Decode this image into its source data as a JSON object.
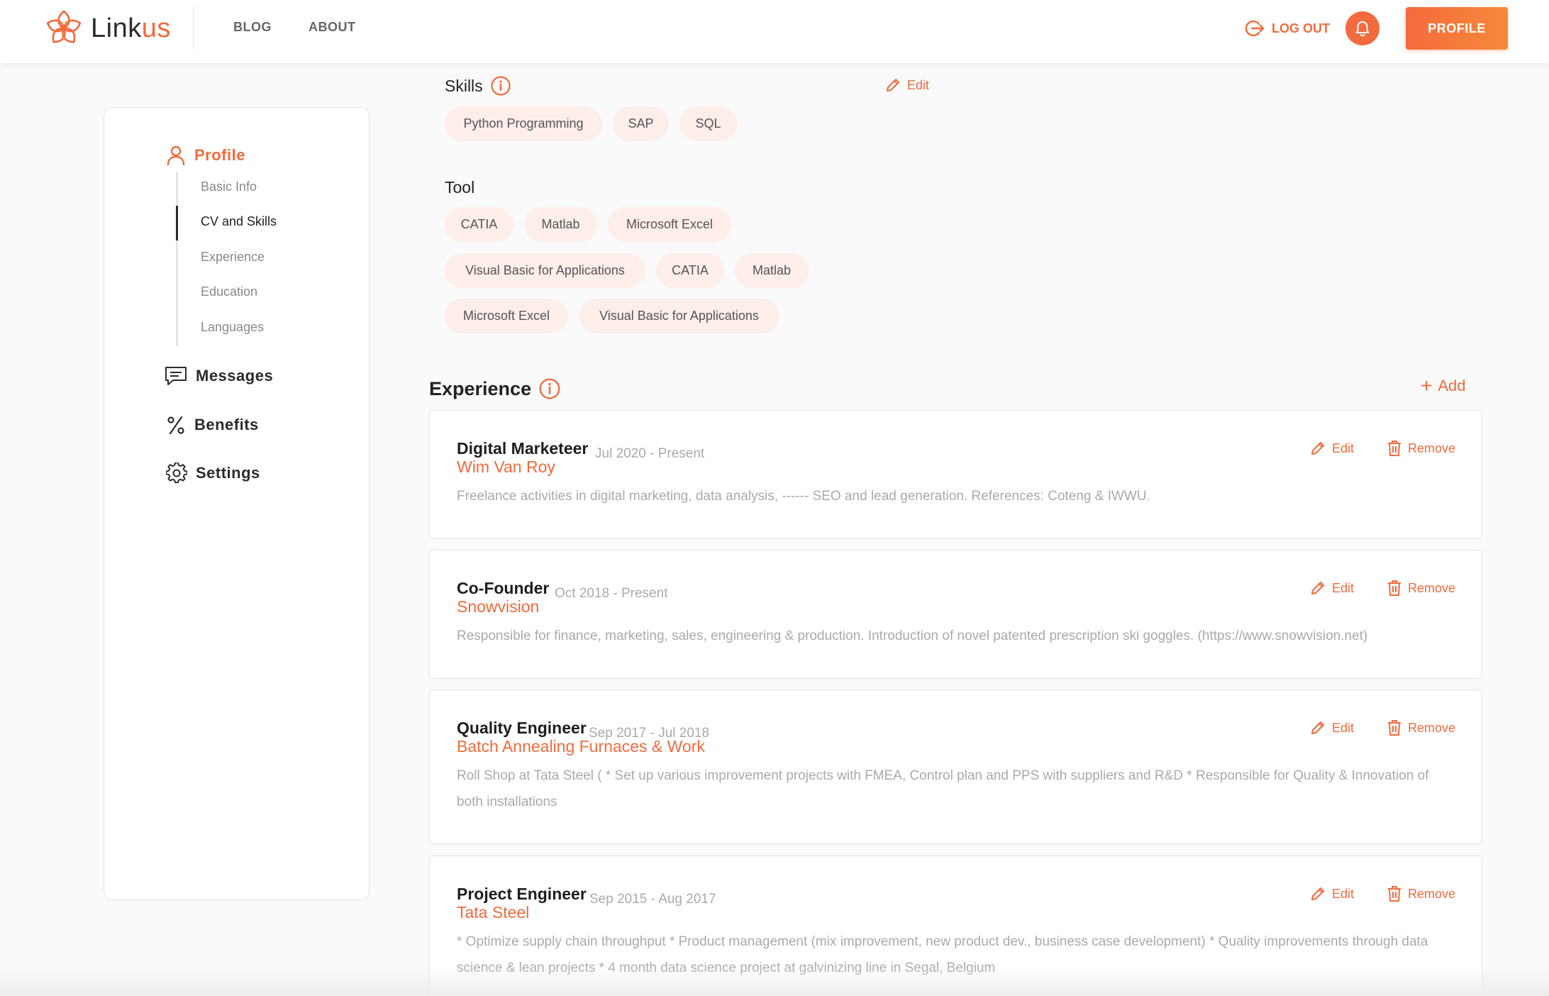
{
  "brand": {
    "name_main": "Link",
    "name_accent": "us",
    "accent_color": "#f26a3d"
  },
  "nav": {
    "blog": "BLOG",
    "about": "ABOUT"
  },
  "header_actions": {
    "logout": "LOG OUT",
    "profile": "PROFILE",
    "bell_icon": "bell-icon"
  },
  "sidebar": {
    "profile": "Profile",
    "sub_items": [
      "Basic Info",
      "CV and Skills",
      "Experience",
      "Education",
      "Languages"
    ],
    "active_sub": "CV and Skills",
    "messages": "Messages",
    "benefits": "Benefits",
    "settings": "Settings"
  },
  "skills": {
    "title": "Skills",
    "edit": "Edit",
    "items": [
      "Python Programming",
      "SAP",
      "SQL"
    ]
  },
  "tool": {
    "title": "Tool",
    "items": [
      "CATIA",
      "Matlab",
      "Microsoft Excel",
      "Visual Basic for Applications",
      "CATIA",
      "Matlab",
      "Microsoft Excel",
      "Visual Basic for Applications"
    ]
  },
  "experience": {
    "title": "Experience",
    "add": "Add",
    "edit_label": "Edit",
    "remove_label": "Remove",
    "items": [
      {
        "title": "Digital Marketeer",
        "company": "Wim Van Roy",
        "date": "Jul 2020 - Present",
        "description": "Freelance activities in digital marketing, data analysis, ------ SEO and lead generation. References: Coteng & IWWU."
      },
      {
        "title": "Co-Founder",
        "company": "Snowvision",
        "date": "Oct 2018 - Present",
        "description": "Responsible for finance, marketing, sales, engineering & production. Introduction of novel patented prescription ski goggles. (https://www.snowvision.net)"
      },
      {
        "title": "Quality Engineer",
        "company": "Batch Annealing Furnaces & Work",
        "date": "Sep 2017 - Jul 2018",
        "description": "Roll Shop at Tata Steel ( * Set up various improvement projects with FMEA, Control plan and PPS with suppliers and R&D * Responsible for Quality & Innovation of both installations"
      },
      {
        "title": "Project Engineer",
        "company": "Tata Steel",
        "date": "Sep 2015 - Aug 2017",
        "description": "* Optimize supply chain throughput * Product management (mix improvement, new product dev., business case development) * Quality improvements through data science & lean projects * 4 month data science project at galvinizing line in Segal, Belgium"
      }
    ]
  }
}
